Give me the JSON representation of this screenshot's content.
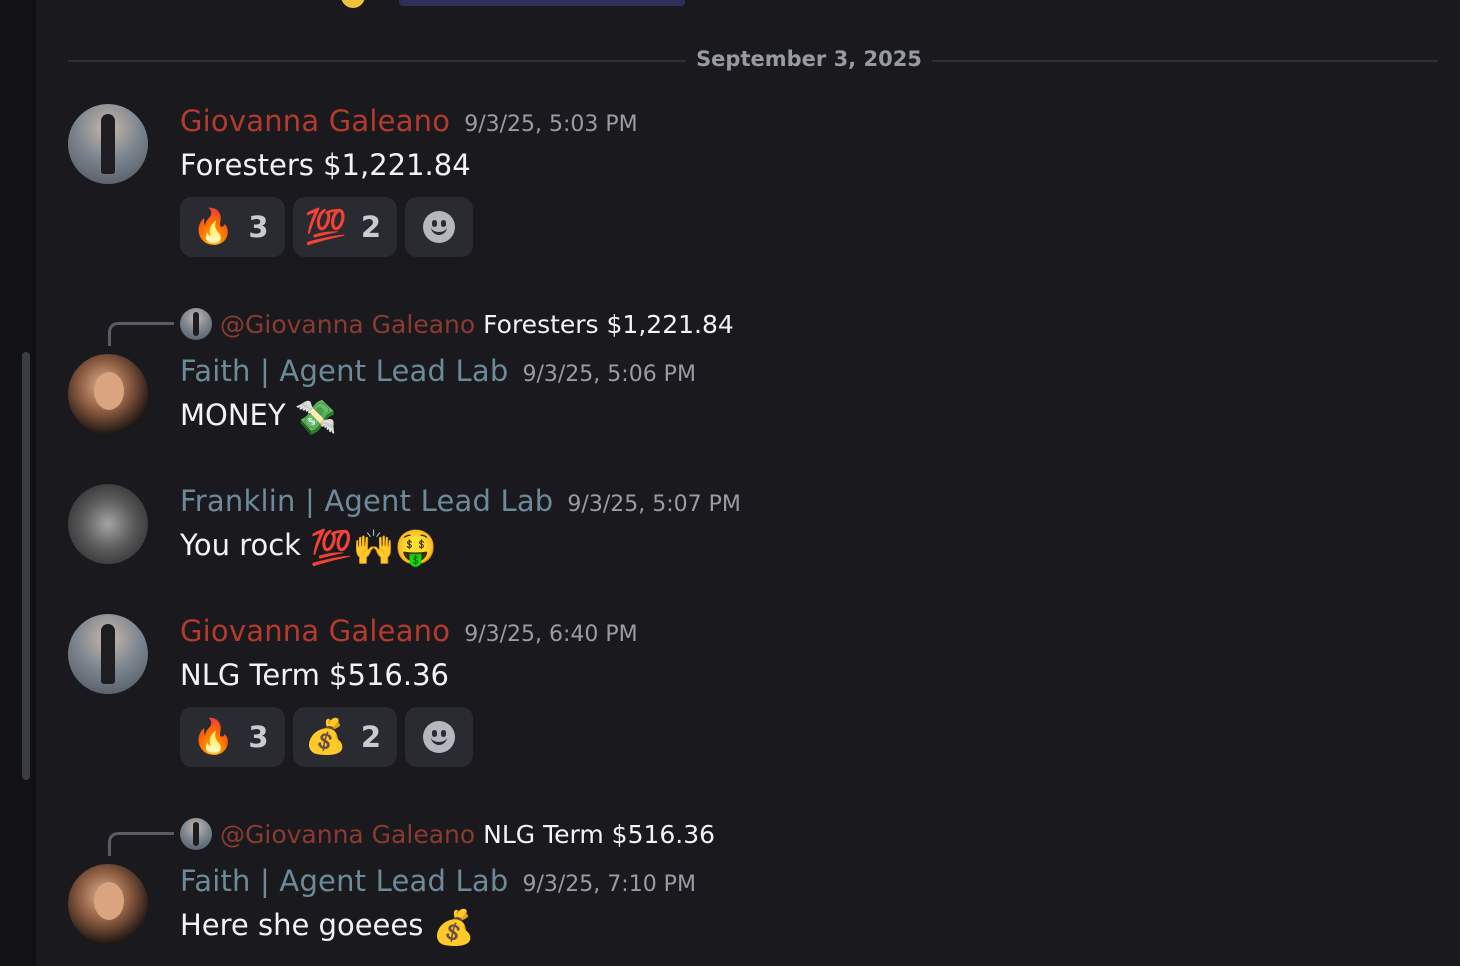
{
  "date_divider": "September 3, 2025",
  "messages": [
    {
      "author": "Giovanna Galeano",
      "timestamp": "9/3/25, 5:03 PM",
      "text": "Foresters $1,221.84",
      "reactions": [
        {
          "emoji": "🔥",
          "count": "3"
        },
        {
          "emoji": "💯",
          "count": "2"
        }
      ]
    },
    {
      "reply_to": {
        "name": "@Giovanna Galeano",
        "text": "Foresters $1,221.84"
      },
      "author": "Faith | Agent Lead Lab",
      "timestamp": "9/3/25, 5:06 PM",
      "text": "MONEY",
      "emoji": "💸"
    },
    {
      "author": "Franklin | Agent Lead Lab",
      "timestamp": "9/3/25, 5:07 PM",
      "text": "You rock",
      "emoji": "💯🙌🤑"
    },
    {
      "author": "Giovanna Galeano",
      "timestamp": "9/3/25, 6:40 PM",
      "text": "NLG Term $516.36",
      "reactions": [
        {
          "emoji": "🔥",
          "count": "3"
        },
        {
          "emoji": "💰",
          "count": "2"
        }
      ]
    },
    {
      "reply_to": {
        "name": "@Giovanna Galeano",
        "text": "NLG Term $516.36"
      },
      "author": "Faith | Agent Lead Lab",
      "timestamp": "9/3/25, 7:10 PM",
      "text": "Here she goeees",
      "emoji": "💰"
    }
  ],
  "colors": {
    "background": "#1a1a1e",
    "giovanna_name": "#b33a2c",
    "agent_name": "#6d8a99",
    "reaction_bg": "#2a2b30"
  },
  "icons": {
    "add_reaction": "smile-icon"
  }
}
